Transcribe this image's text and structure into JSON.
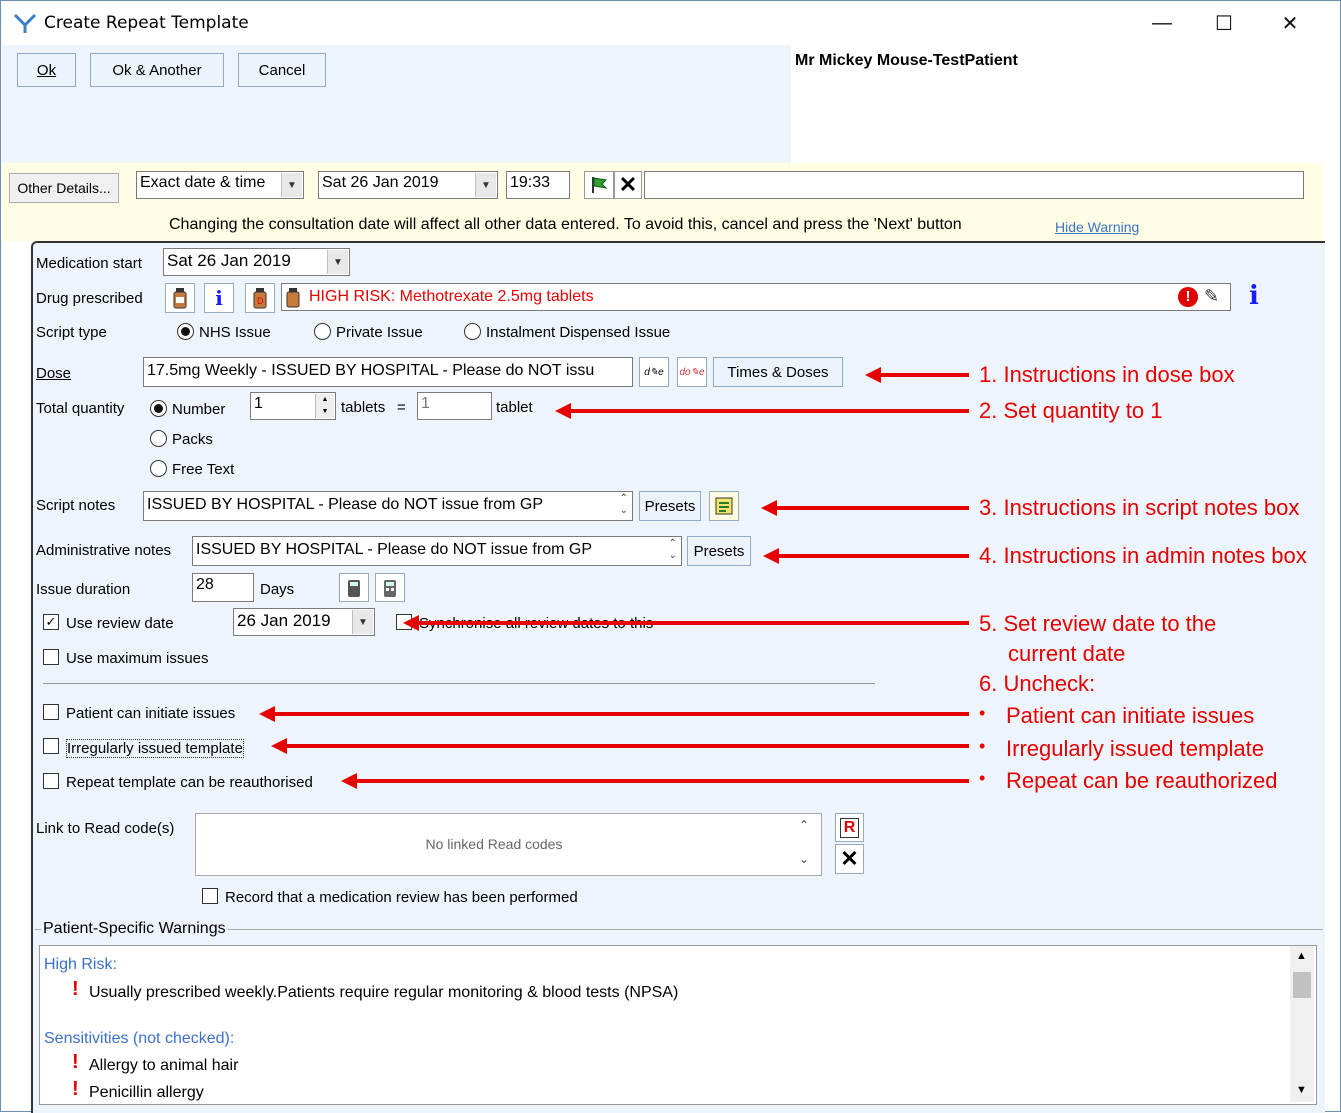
{
  "window": {
    "title": "Create Repeat Template"
  },
  "toolbar": {
    "ok_label": "Ok",
    "ok_another_label": "Ok & Another",
    "cancel_label": "Cancel"
  },
  "patient": {
    "name": "Mr Mickey Mouse-TestPatient"
  },
  "consultation": {
    "other_details_label": "Other Details...",
    "date_mode": "Exact date & time",
    "date": "Sat 26 Jan 2019",
    "time": "19:33",
    "free_text": "",
    "warning_text": "Changing the consultation date will affect all other data entered. To avoid this, cancel and press the 'Next' button",
    "hide_warning_label": "Hide Warning"
  },
  "form": {
    "medication_start_label": "Medication start",
    "medication_start_value": "Sat 26 Jan 2019",
    "drug_prescribed_label": "Drug prescribed",
    "drug_prescribed_value": "HIGH RISK: Methotrexate 2.5mg tablets",
    "script_type_label": "Script type",
    "script_types": [
      "NHS Issue",
      "Private Issue",
      "Instalment Dispensed Issue"
    ],
    "dose_label": "Dose",
    "dose_value": "17.5mg Weekly - ISSUED BY HOSPITAL - Please do NOT issu",
    "times_doses_label": "Times & Doses",
    "total_quantity_label": "Total quantity",
    "quantity_modes": [
      "Number",
      "Packs",
      "Free Text"
    ],
    "quantity_value": "1",
    "tablets_label": "tablets",
    "equals": "=",
    "quantity_value2": "1",
    "tablet_label": "tablet",
    "script_notes_label": "Script notes",
    "script_notes_value": "ISSUED BY HOSPITAL - Please do NOT issue from GP",
    "presets_label": "Presets",
    "admin_notes_label": "Administrative notes",
    "admin_notes_value": "ISSUED BY HOSPITAL - Please do NOT issue from GP",
    "issue_duration_label": "Issue duration",
    "issue_duration_value": "28",
    "days_label": "Days",
    "use_review_date_label": "Use review date",
    "review_date_value": "26 Jan 2019",
    "sync_review_label": "Synchronise all review dates to this",
    "use_max_issues_label": "Use maximum issues",
    "patient_initiate_label": "Patient can initiate issues",
    "irregular_label": "Irregularly issued template",
    "reauthorised_label": "Repeat template can be reauthorised",
    "link_read_label": "Link to Read code(s)",
    "no_read_codes": "No linked Read codes",
    "record_review_label": "Record that a medication review has been performed"
  },
  "warnings": {
    "group_label": "Patient-Specific Warnings",
    "high_risk_heading": "High Risk:",
    "high_risk_items": [
      "Usually prescribed weekly.Patients require regular monitoring & blood tests (NPSA)"
    ],
    "sensitivities_heading": "Sensitivities (not checked):",
    "sensitivity_items": [
      "Allergy to animal hair",
      "Penicillin allergy"
    ]
  },
  "annotations": {
    "a1": "1. Instructions in dose box",
    "a2": "2. Set quantity to 1",
    "a3": "3. Instructions in script notes box",
    "a4": "4. Instructions in admin notes box",
    "a5_line1": "5. Set review date to the",
    "a5_line2": "current date",
    "a6": "6. Uncheck:",
    "bullet": "•",
    "a6_items": [
      "Patient can initiate issues",
      "Irregularly issued template",
      "Repeat can be reauthorized"
    ]
  },
  "colors": {
    "annotation_red": "#e60000",
    "high_risk_red": "#e60000",
    "link_blue": "#3b72c8",
    "panel_bg": "#eef4fb"
  }
}
